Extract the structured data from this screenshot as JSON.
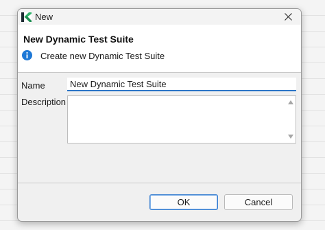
{
  "window": {
    "title": "New",
    "app_icon": "katalon-k-icon",
    "close_icon": "close-icon"
  },
  "header": {
    "title": "New Dynamic Test Suite",
    "info_icon": "info-icon",
    "message": "Create new Dynamic Test Suite"
  },
  "form": {
    "name_label": "Name",
    "name_value": "New Dynamic Test Suite",
    "description_label": "Description",
    "description_value": ""
  },
  "buttons": {
    "ok_label": "OK",
    "cancel_label": "Cancel"
  },
  "colors": {
    "accent": "#2a74c7",
    "info": "#1e78d6",
    "logo_green": "#2fb36b",
    "logo_dark": "#1c2b33"
  }
}
